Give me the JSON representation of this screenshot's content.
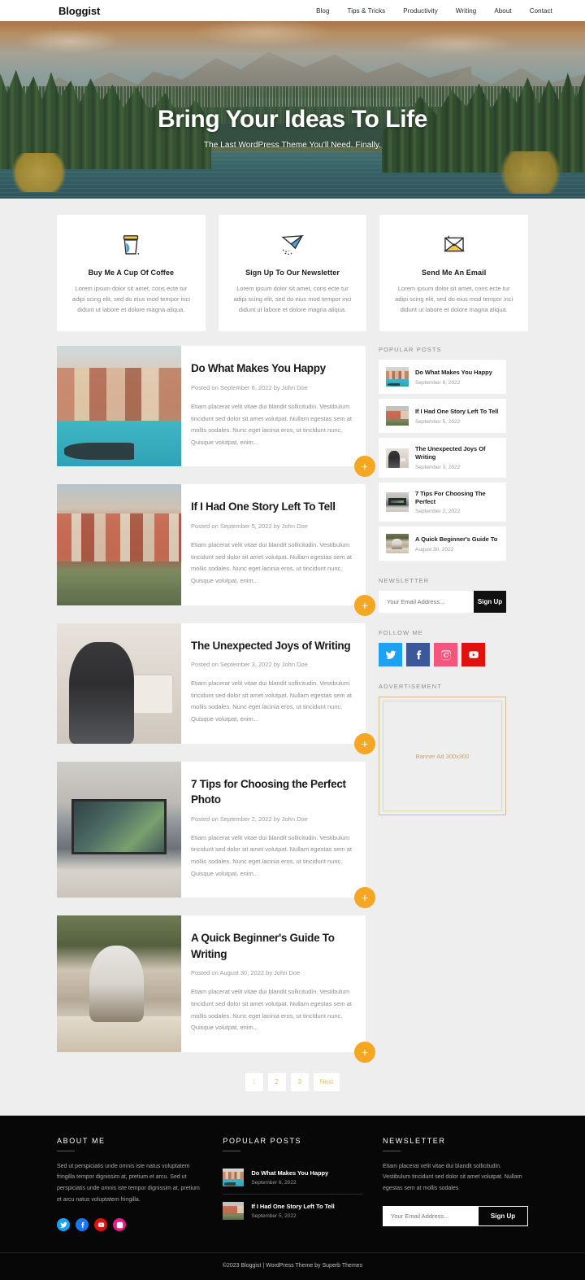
{
  "header": {
    "brand": "Bloggist",
    "nav": [
      {
        "label": "Blog"
      },
      {
        "label": "Tips & Tricks"
      },
      {
        "label": "Productivity"
      },
      {
        "label": "Writing"
      },
      {
        "label": "About"
      },
      {
        "label": "Contact"
      }
    ]
  },
  "hero": {
    "title": "Bring Your Ideas To Life",
    "subtitle": "The Last WordPress Theme You'll Need. Finally."
  },
  "features": [
    {
      "icon": "coffee-cup-icon",
      "title": "Buy Me A Cup Of Coffee",
      "text": "Lorem ipsum dolor sit amet, cons ecte tur adipi scing elit, sed do eius mod tempor inci didunt ut labore et dolore magna aliqua."
    },
    {
      "icon": "paper-plane-icon",
      "title": "Sign Up To Our Newsletter",
      "text": "Lorem ipsum dolor sit amet, cons ecte tur adipi scing elit, sed do eius mod tempor inci didunt ut labore et dolore magna aliqua."
    },
    {
      "icon": "envelope-icon",
      "title": "Send Me An Email",
      "text": "Lorem ipsum dolor sit amet, cons ecte tur adipi scing elit, sed do eius mod tempor inci didunt ut labore et dolore magna aliqua."
    }
  ],
  "posts": [
    {
      "title": "Do What Makes You Happy",
      "meta": "Posted on September 6, 2022 by John Doe",
      "excerpt": "Etiam placerat velit vitae dui blandit sollicitudin. Vestibulum tincidunt sed dolor sit amet volutpat. Nullam egestas sem at mollis sodales. Nunc eget lacinia eros, ut tincidunt nunc. Quisque volutpat, enim...",
      "thumb": "venice-canal-photo",
      "more_label": "+"
    },
    {
      "title": "If I Had One Story Left To Tell",
      "meta": "Posted on September 5, 2022 by John Doe",
      "excerpt": "Etiam placerat velit vitae dui blandit sollicitudin. Vestibulum tincidunt sed dolor sit amet volutpat. Nullam egestas sem at mollis sodales. Nunc eget lacinia eros, ut tincidunt nunc. Quisque volutpat, enim...",
      "thumb": "hillside-town-photo",
      "more_label": "+"
    },
    {
      "title": "The Unexpected Joys of Writing",
      "meta": "Posted on September 3, 2022 by John Doe",
      "excerpt": "Etiam placerat velit vitae dui blandit sollicitudin. Vestibulum tincidunt sed dolor sit amet volutpat. Nullam egestas sem at mollis sodales. Nunc eget lacinia eros, ut tincidunt nunc. Quisque volutpat, enim...",
      "thumb": "woman-writing-laptop-photo",
      "more_label": "+"
    },
    {
      "title": "7 Tips for Choosing the Perfect Photo",
      "meta": "Posted on September 2, 2022 by John Doe",
      "excerpt": "Etiam placerat velit vitae dui blandit sollicitudin. Vestibulum tincidunt sed dolor sit amet volutpat. Nullam egestas sem at mollis sodales. Nunc eget lacinia eros, ut tincidunt nunc. Quisque volutpat, enim...",
      "thumb": "desk-monitor-photos-photo",
      "more_label": "+"
    },
    {
      "title": "A Quick Beginner's Guide To Writing",
      "meta": "Posted on August 30, 2022 by John Doe",
      "excerpt": "Etiam placerat velit vitae dui blandit sollicitudin. Vestibulum tincidunt sed dolor sit amet volutpat. Nullam egestas sem at mollis sodales. Nunc eget lacinia eros, ut tincidunt nunc. Quisque volutpat, enim...",
      "thumb": "person-writing-notebook-photo",
      "more_label": "+"
    }
  ],
  "pagination": {
    "items": [
      {
        "label": "1",
        "active": true
      },
      {
        "label": "2",
        "active": false
      },
      {
        "label": "3",
        "active": false
      },
      {
        "label": "Next",
        "active": false
      }
    ]
  },
  "sidebar": {
    "popular_heading": "POPULAR POSTS",
    "popular_posts": [
      {
        "title": "Do What Makes You Happy",
        "date": "September 6, 2022",
        "thumb": "venice-canal-photo"
      },
      {
        "title": "If I Had One Story Left To Tell",
        "date": "September 5, 2022",
        "thumb": "hillside-town-photo"
      },
      {
        "title": "The Unexpected Joys Of Writing",
        "date": "September 3, 2022",
        "thumb": "woman-writing-laptop-photo"
      },
      {
        "title": "7 Tips For Choosing The Perfect",
        "date": "September 2, 2022",
        "thumb": "desk-monitor-photos-photo"
      },
      {
        "title": "A Quick Beginner's Guide To",
        "date": "August 30, 2022",
        "thumb": "person-writing-notebook-photo"
      }
    ],
    "newsletter_heading": "NEWSLETTER",
    "newsletter_placeholder": "Your Email Address...",
    "newsletter_value": "",
    "newsletter_button": "Sign Up",
    "follow_heading": "FOLLOW ME",
    "socials": [
      {
        "name": "twitter-icon",
        "color": "#1da1f2"
      },
      {
        "name": "facebook-icon",
        "color": "#3b5998"
      },
      {
        "name": "instagram-icon",
        "color": "#f4557f"
      },
      {
        "name": "youtube-icon",
        "color": "#e1110f"
      }
    ],
    "ad_heading": "ADVERTISEMENT",
    "ad_text": "Banner Ad 300x300"
  },
  "footer": {
    "about_heading": "ABOUT ME",
    "about_text": "Sed ut perspiciatis unde omnis iste natus voluptatem fringilla tempor dignissim at, pretium et arcu. Sed ut perspiciatis unde omnis iste tempor dignissim at, pretium et arcu natus voluptatem fringilla.",
    "socials": [
      {
        "name": "twitter-icon",
        "color": "#1da1f2"
      },
      {
        "name": "facebook-icon",
        "color": "#1877f2"
      },
      {
        "name": "youtube-icon",
        "color": "#e1110f"
      },
      {
        "name": "instagram-icon",
        "color": "#ec1a8d"
      }
    ],
    "popular_heading": "POPULAR POSTS",
    "popular_posts": [
      {
        "title": "Do What Makes You Happy",
        "date": "September 6, 2022",
        "thumb": "venice-canal-photo"
      },
      {
        "title": "If I Had One Story Left To Tell",
        "date": "September 5, 2022",
        "thumb": "hillside-town-photo"
      }
    ],
    "newsletter_heading": "NEWSLETTER",
    "newsletter_text": "Etiam placerat velit vitae dui blandit sollicitudin. Vestibulum tincidunt sed dolor sit amet volutpat. Nullam egestas sem at mollis sodales",
    "newsletter_placeholder": "Your Email Address...",
    "newsletter_value": "",
    "newsletter_button": "Sign Up",
    "copyright": "©2023 Bloggist | WordPress Theme by Superb Themes"
  },
  "colors": {
    "accent_orange": "#f5a623",
    "pagination_gold": "#e9bd5e",
    "body_bg": "#eeeeee",
    "footer_bg": "#070707"
  }
}
